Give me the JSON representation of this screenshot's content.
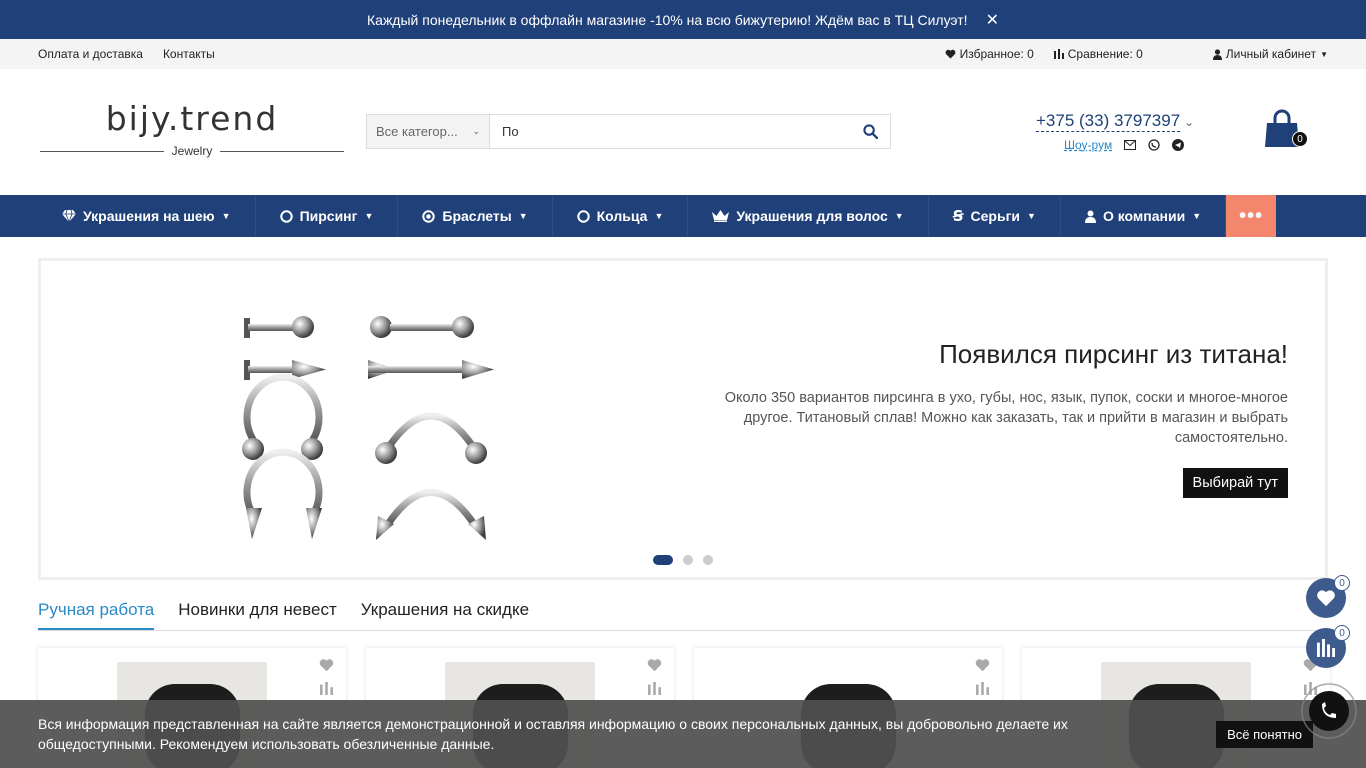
{
  "promo": {
    "text": "Каждый понедельник в оффлайн магазине -10% на всю бижутерию! Ждём вас в ТЦ Силуэт!",
    "close": "✕"
  },
  "topbar": {
    "links": [
      "Оплата и доставка",
      "Контакты"
    ],
    "favorites": "Избранное: 0",
    "compare": "Сравнение: 0",
    "account": "Личный кабинет"
  },
  "logo": {
    "brand": "bijy.trend",
    "sub": "Jewelry"
  },
  "search": {
    "category": "Все категор...",
    "value": "По"
  },
  "contacts": {
    "phone": "+375 (33) 3797397",
    "showroom": "Шоу-рум"
  },
  "cart": {
    "count": "0"
  },
  "nav": {
    "items": [
      {
        "label": "Украшения на шею",
        "icon": "diamond-icon"
      },
      {
        "label": "Пирсинг",
        "icon": "ring-outline-icon"
      },
      {
        "label": "Браслеты",
        "icon": "dot-circle-icon"
      },
      {
        "label": "Кольца",
        "icon": "ring-outline-icon"
      },
      {
        "label": "Украшения для волос",
        "icon": "crown-icon"
      },
      {
        "label": "Серьги",
        "icon": "earring-icon"
      },
      {
        "label": "О компании",
        "icon": "user-icon"
      }
    ],
    "more": "•••"
  },
  "slider": {
    "title": "Появился пирсинг из титана!",
    "text": "Около 350 вариантов пирсинга в ухо, губы, нос, язык, пупок, соски и многое-многое другое. Титановый сплав! Можно как заказать, так и прийти в магазин и выбрать самостоятельно.",
    "cta": "Выбирай тут"
  },
  "tabs": [
    "Ручная работа",
    "Новинки для невест",
    "Украшения на скидке"
  ],
  "floating": {
    "favorites_count": "0",
    "compare_count": "0"
  },
  "cookie": {
    "text": "Вся информация представленная на сайте является демонстрационной и оставляя информацию о своих персональных данных, вы добровольно делаете их общедоступными. Рекомендуем использовать обезличенные данные.",
    "button": "Всё понятно"
  },
  "colors": {
    "primary": "#1f4079",
    "accent": "#f3866d",
    "link": "#2b8ac6"
  }
}
